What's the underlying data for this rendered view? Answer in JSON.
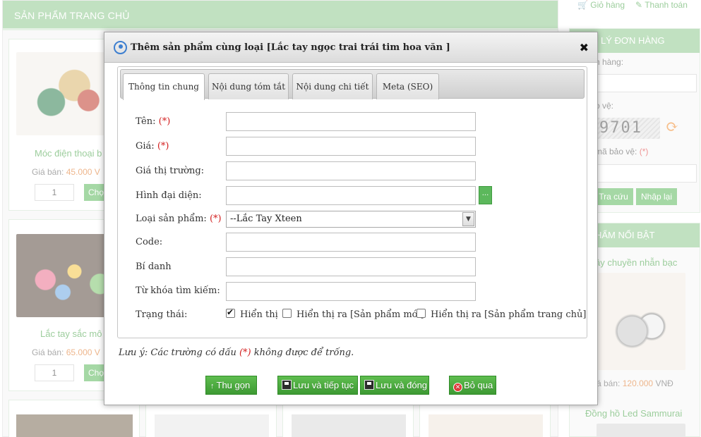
{
  "background": {
    "section_title": "SẢN PHẨM TRANG CHỦ",
    "price_label": "Giá bán:",
    "add_label": "Chọ",
    "products": [
      {
        "name": "Móc điện thoại b",
        "price": "45.000 V",
        "qty": "1"
      },
      {
        "name": "Lắc tay sắc mô",
        "price": "65.000 V",
        "qty": "1"
      }
    ],
    "sidebar": {
      "cart_label": "Giỏ hàng",
      "pay_label": "Thanh toán",
      "order_box_title": "LÝ ĐƠN HÀNG",
      "order_code_label": "n hàng:",
      "captcha_label": "o vệ:",
      "captcha_text": "9701",
      "enter_captcha_label": "mã bảo vệ:",
      "required_mark": "(*)",
      "lookup_button": "Tra cứu",
      "reset_button": "Nhập lại",
      "featured_title": "HẨM NỔI BẬT",
      "featured_product_name": "ây chuyền nhẫn bạc",
      "featured_price_label": "á bán:",
      "featured_price": "120.000",
      "featured_currency": "VNĐ",
      "second_product_name": "Đồng hồ Led Sammurai"
    }
  },
  "dialog": {
    "title": "Thêm sản phẩm cùng loại [Lắc tay ngọc trai trái tim hoa văn ]",
    "close_symbol": "✖",
    "tabs": [
      {
        "label": "Thông tin chung"
      },
      {
        "label": "Nội dung tóm tắt"
      },
      {
        "label": "Nội dung chi tiết"
      },
      {
        "label": "Meta (SEO)"
      }
    ],
    "required_mark": "(*)",
    "fields": {
      "name_label": "Tên:",
      "name_value": "",
      "price_label": "Giá:",
      "price_value": "",
      "market_price_label": "Giá thị trường:",
      "market_price_value": "",
      "avatar_label": "Hình đại diện:",
      "avatar_value": "",
      "browse_button": "...",
      "category_label": "Loại sản phẩm:",
      "category_value": "--Lắc Tay Xteen",
      "code_label": "Code:",
      "code_value": "",
      "alias_label": "Bí danh",
      "alias_value": "",
      "keywords_label": "Từ khóa tìm kiếm:",
      "keywords_value": "",
      "status_label": "Trạng thái:"
    },
    "status_options": [
      {
        "label": "Hiển thị",
        "checked": true
      },
      {
        "label": "Hiển thị ra [Sản phẩm mới]",
        "checked": false
      },
      {
        "label": "Hiển thị ra [Sản phẩm trang chủ]",
        "checked": false
      }
    ],
    "note_prefix": "Lưu ý: Các trường có dấu",
    "note_suffix": "không được để trống.",
    "buttons": {
      "collapse": "Thu gọn",
      "save_continue": "Lưu và tiếp tục",
      "save_close": "Lưu và đóng",
      "skip": "Bỏ qua"
    }
  }
}
